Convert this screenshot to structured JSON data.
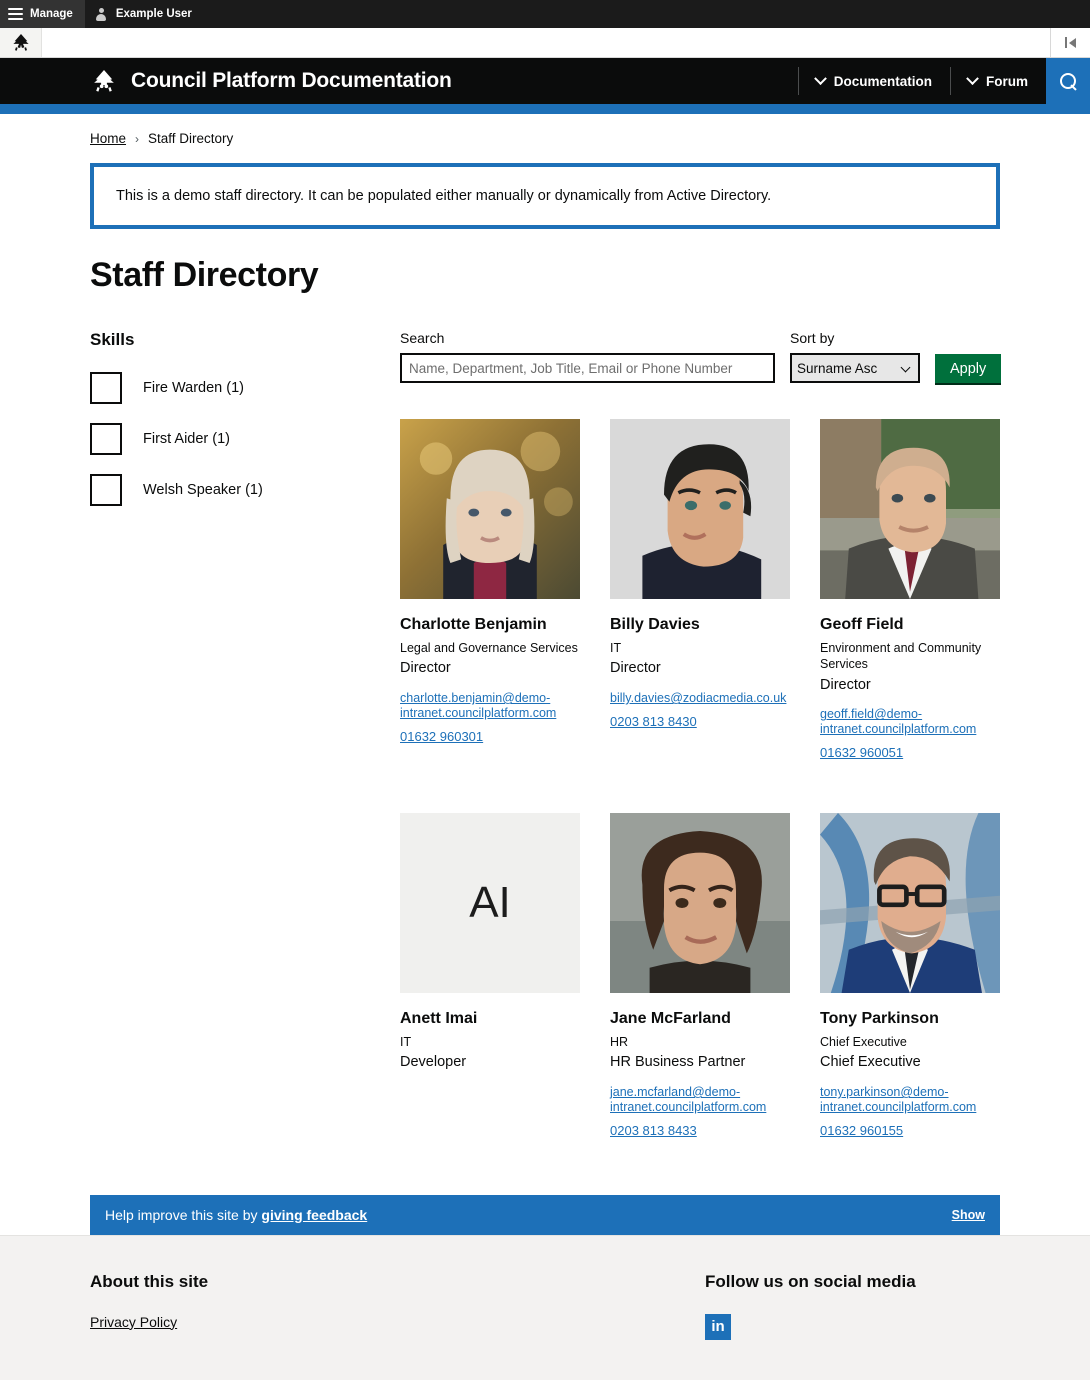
{
  "admin_bar": {
    "manage_label": "Manage",
    "user_label": "Example User",
    "menu_icon": "hamburger-icon",
    "user_icon": "user-avatar-icon",
    "collapse_icon": "collapse-sidebar-icon"
  },
  "header": {
    "logo_icon": "council-crest-logo",
    "title": "Council Platform Documentation",
    "nav": [
      {
        "label": "Documentation",
        "icon": "chevron-down-icon"
      },
      {
        "label": "Forum",
        "icon": "chevron-down-icon"
      }
    ],
    "search_icon": "search-icon",
    "accent_color": "#1d70b8"
  },
  "breadcrumb": {
    "home": "Home",
    "separator": "›",
    "current": "Staff Directory"
  },
  "notice": {
    "text": "This is a demo staff directory. It can be populated either manually or dynamically from Active Directory."
  },
  "page_title": "Staff Directory",
  "facets": {
    "heading": "Skills",
    "items": [
      {
        "label": "Fire Warden (1)",
        "checked": false
      },
      {
        "label": "First Aider (1)",
        "checked": false
      },
      {
        "label": "Welsh Speaker (1)",
        "checked": false
      }
    ]
  },
  "controls": {
    "search_label": "Search",
    "search_value": "",
    "search_placeholder": "Name, Department, Job Title, Email or Phone Number",
    "sort_label": "Sort by",
    "sort_value": "Surname Asc",
    "sort_options": [
      "Surname Asc"
    ],
    "apply_label": "Apply",
    "apply_color": "#00703c"
  },
  "staff": [
    {
      "name": "Charlotte Benjamin",
      "department": "Legal and Governance Services",
      "role": "Director",
      "email": "charlotte.benjamin@demo-intranet.councilplatform.com",
      "phone": "01632 960301",
      "photo_type": "portrait",
      "photo_alt": "Photo of Charlotte Benjamin"
    },
    {
      "name": "Billy Davies",
      "department": "IT",
      "role": "Director",
      "email": "billy.davies@zodiacmedia.co.uk",
      "phone": "0203 813 8430",
      "photo_type": "portrait",
      "photo_alt": "Photo of Billy Davies"
    },
    {
      "name": "Geoff Field",
      "department": "Environment and Community Services",
      "role": "Director",
      "email": "geoff.field@demo-intranet.councilplatform.com",
      "phone": "01632 960051",
      "photo_type": "portrait",
      "photo_alt": "Photo of Geoff Field"
    },
    {
      "name": "Anett Imai",
      "department": "IT",
      "role": "Developer",
      "email": "",
      "phone": "",
      "photo_type": "initials",
      "initials": "AI",
      "photo_alt": "Placeholder initials for Anett Imai"
    },
    {
      "name": "Jane McFarland",
      "department": "HR",
      "role": "HR Business Partner",
      "email": "jane.mcfarland@demo-intranet.councilplatform.com",
      "phone": "0203 813 8433",
      "photo_type": "portrait",
      "photo_alt": "Photo of Jane McFarland"
    },
    {
      "name": "Tony Parkinson",
      "department": "Chief Executive",
      "role": "Chief Executive",
      "email": "tony.parkinson@demo-intranet.councilplatform.com",
      "phone": "01632 960155",
      "photo_type": "portrait",
      "photo_alt": "Photo of Tony Parkinson"
    }
  ],
  "feedback": {
    "prefix": "Help improve this site by ",
    "link": "giving feedback",
    "show": "Show"
  },
  "footer": {
    "about_heading": "About this site",
    "privacy_label": "Privacy Policy",
    "social_heading": "Follow us on social media",
    "social_icon": "linkedin-icon",
    "social_glyph": "in"
  }
}
